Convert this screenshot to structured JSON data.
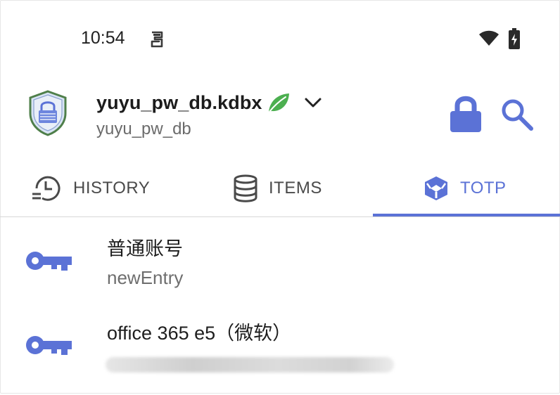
{
  "status_bar": {
    "time": "10:54",
    "icons": [
      "app-notification-icon",
      "wifi-icon",
      "battery-icon"
    ]
  },
  "header": {
    "db_filename": "yuyu_pw_db.kdbx",
    "db_name": "yuyu_pw_db",
    "icons": [
      "database-shield-icon",
      "leaf-icon",
      "chevron-down-icon",
      "lock-icon",
      "search-icon"
    ]
  },
  "tabs": [
    {
      "label": "HISTORY",
      "icon": "history-icon",
      "selected": false
    },
    {
      "label": "ITEMS",
      "icon": "database-icon",
      "selected": false
    },
    {
      "label": "TOTP",
      "icon": "totp-cube-icon",
      "selected": true
    }
  ],
  "entries": [
    {
      "title": "普通账号",
      "subtitle": "newEntry",
      "icon": "key-icon"
    },
    {
      "title": "office 365 e5（微软）",
      "subtitle_blurred": true,
      "icon": "key-icon"
    }
  ],
  "colors": {
    "accent": "#5b72d6",
    "leaf": "#4caf50",
    "text_primary": "#1e1e1e",
    "text_secondary": "#6e6e6e"
  }
}
